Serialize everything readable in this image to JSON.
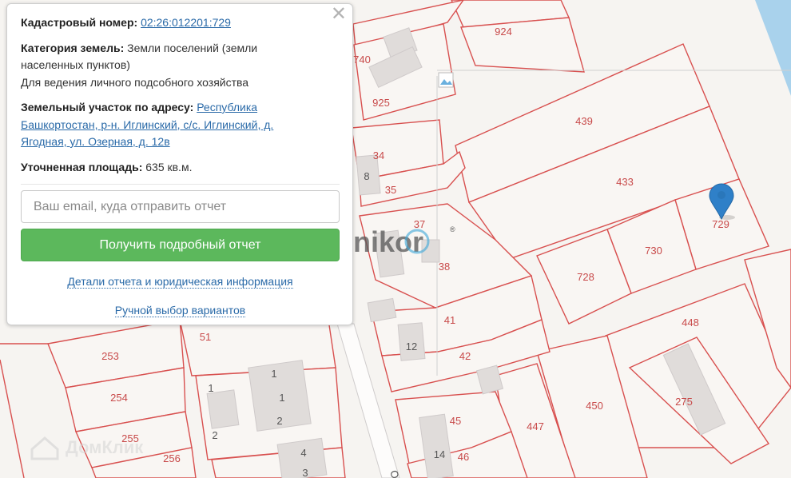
{
  "card": {
    "cadastral_label": "Кадастровый номер:",
    "cadastral_number": "02:26:012201:729",
    "category_label": "Категория земель:",
    "category_value_1": " Земли поселений (земли",
    "category_value_2": "населенных пунктов)",
    "usage": "Для ведения личного подсобного хозяйства",
    "address_label": "Земельный участок по адресу:",
    "address_1": "Республика",
    "address_2": "Башкортостан, р-н. Иглинский, с/с. Иглинский, д.",
    "address_3": "Ягодная, ул. Озерная, д. 12в",
    "area_label": "Уточненная площадь:",
    "area_value": " 635 кв.м.",
    "email_placeholder": "Ваш email, куда отправить отчет",
    "report_button": "Получить подробный отчет",
    "details_link": "Детали отчета и юридическая информация",
    "manual_link": "Ручной выбор вариантов",
    "close_glyph": "✕"
  },
  "map": {
    "watermark": "unikor",
    "watermark_mark": "®",
    "domclick": "ДомКлик",
    "street": "Оз",
    "marker_plot": "729",
    "plots": [
      "924",
      "740",
      "925",
      "439",
      "433",
      "729",
      "730",
      "728",
      "448",
      "450",
      "447",
      "275",
      "253",
      "254",
      "255",
      "256",
      "51",
      "34",
      "35",
      "37",
      "38",
      "41",
      "42",
      "45",
      "46"
    ],
    "buildings": [
      "8",
      "12",
      "14",
      "1",
      "1",
      "1",
      "2",
      "2",
      "4",
      "3"
    ]
  },
  "colors": {
    "plot_border": "#d8504f",
    "button": "#5cb85c",
    "link": "#2a6aa8",
    "marker": "#2f80c8"
  }
}
